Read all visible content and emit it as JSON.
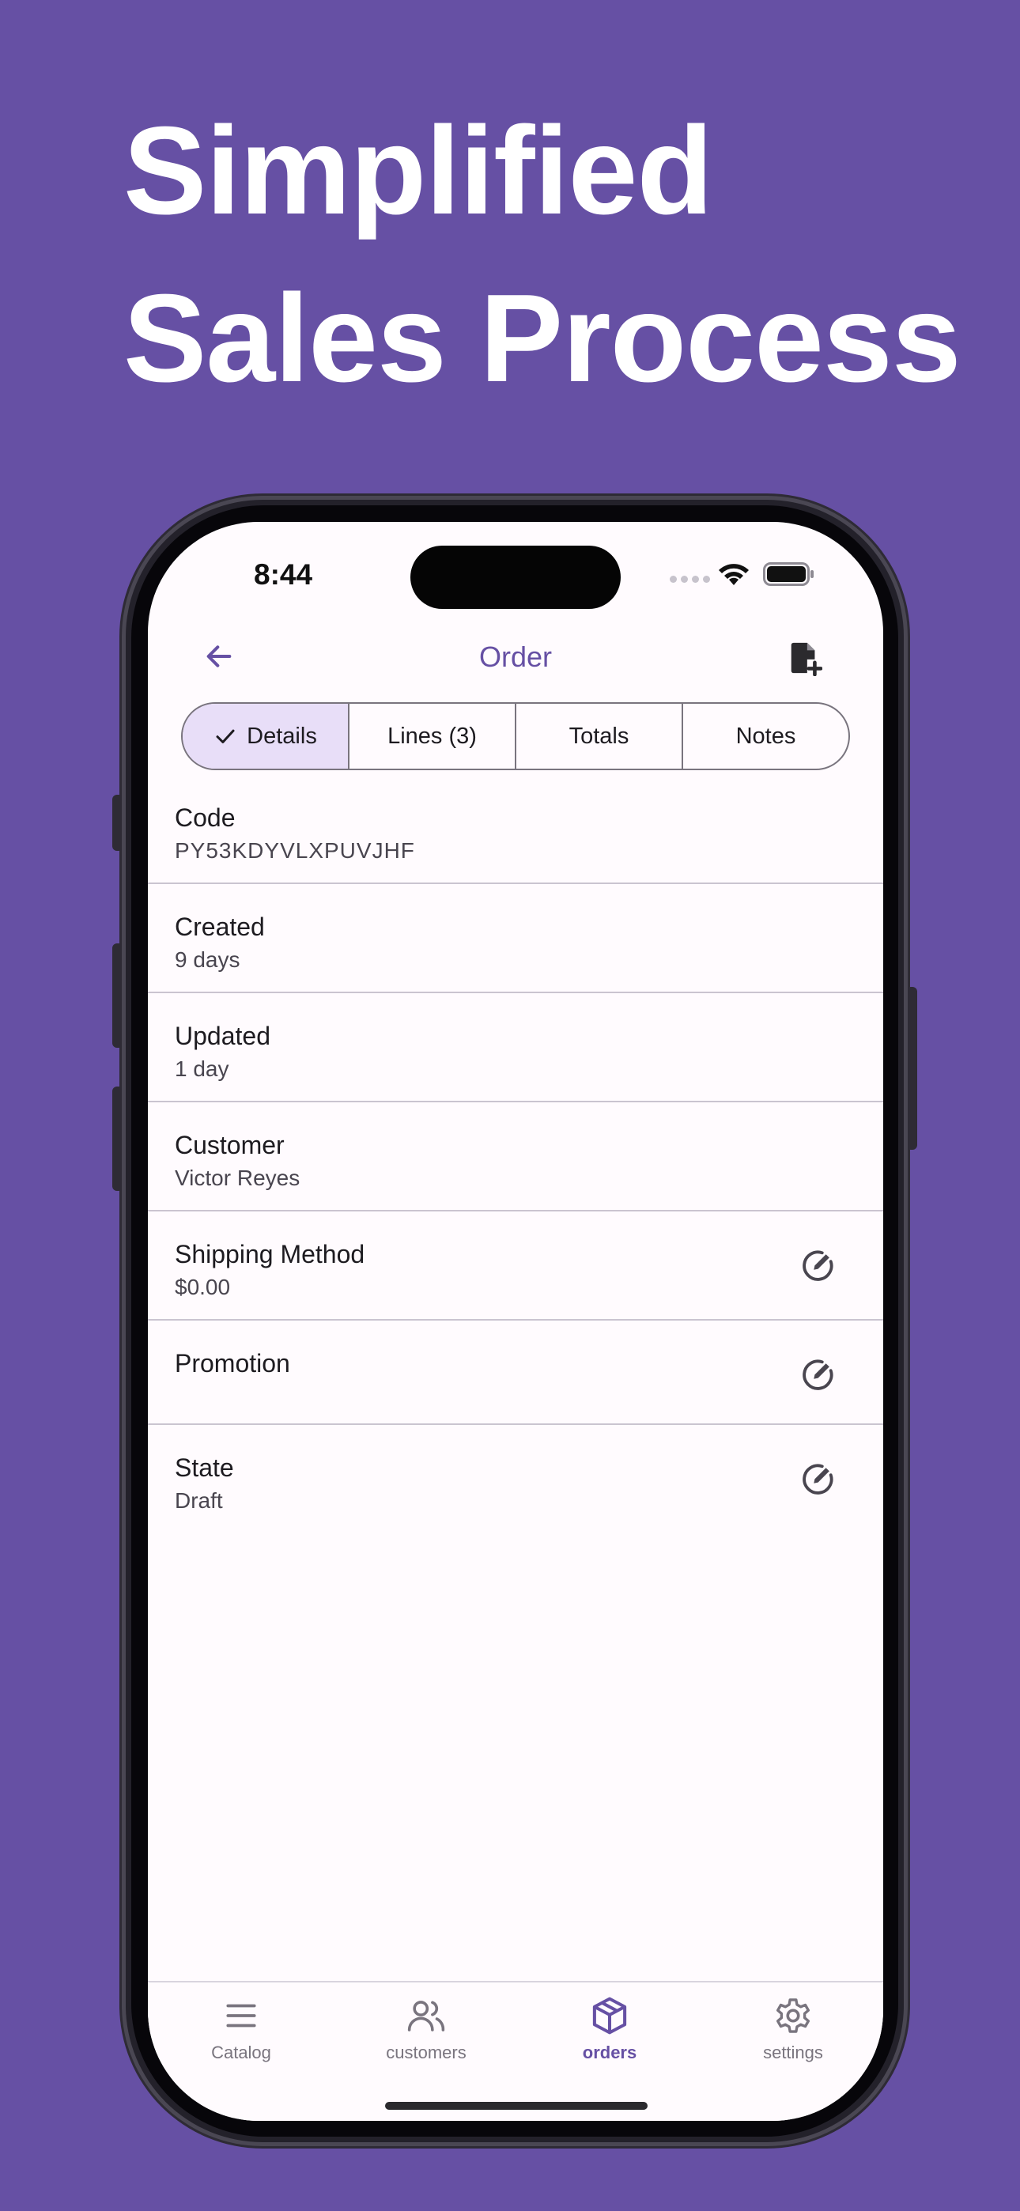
{
  "headline": {
    "line1": "Simplified",
    "line2": "Sales Process"
  },
  "status_bar": {
    "time": "8:44"
  },
  "app_bar": {
    "title": "Order"
  },
  "tabs": [
    {
      "label": "Details",
      "selected": true
    },
    {
      "label": "Lines (3)",
      "selected": false
    },
    {
      "label": "Totals",
      "selected": false
    },
    {
      "label": "Notes",
      "selected": false
    }
  ],
  "fields": {
    "code": {
      "label": "Code",
      "value": "PY53KDYVLXPUVJHF"
    },
    "created": {
      "label": "Created",
      "value": "9 days"
    },
    "updated": {
      "label": "Updated",
      "value": "1 day"
    },
    "customer": {
      "label": "Customer",
      "value": "Victor Reyes"
    },
    "shipping": {
      "label": "Shipping Method",
      "value": "$0.00"
    },
    "promotion": {
      "label": "Promotion",
      "value": ""
    },
    "state": {
      "label": "State",
      "value": "Draft"
    }
  },
  "bottom_nav": [
    {
      "label": "Catalog",
      "icon": "menu-icon",
      "active": false
    },
    {
      "label": "customers",
      "icon": "users-icon",
      "active": false
    },
    {
      "label": "orders",
      "icon": "package-icon",
      "active": true
    },
    {
      "label": "settings",
      "icon": "gear-icon",
      "active": false
    }
  ],
  "colors": {
    "background": "#6650a4",
    "primary": "#6650a4",
    "selected_tab": "#e8def8",
    "surface": "#fffbfe"
  }
}
